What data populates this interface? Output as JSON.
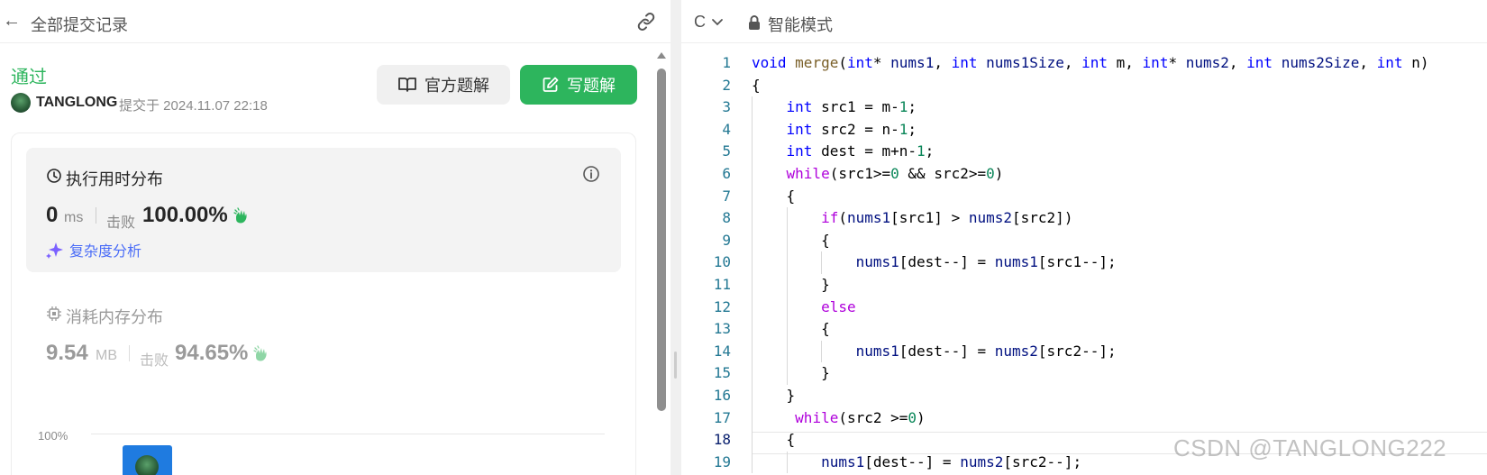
{
  "left_panel": {
    "back_label": "←",
    "title": "全部提交记录",
    "status": "通过",
    "username": "TANGLONG",
    "submitted_text": "提交于 2024.11.07 22:18",
    "official_solution_label": "官方题解",
    "write_solution_label": "写题解",
    "runtime": {
      "title": "执行用时分布",
      "value": "0",
      "unit": "ms",
      "beat_label": "击败",
      "beat_pct": "100.00%",
      "complexity_label": "复杂度分析"
    },
    "memory": {
      "title": "消耗内存分布",
      "value": "9.54",
      "unit": "MB",
      "beat_label": "击败",
      "beat_pct": "94.65%"
    },
    "chart": {
      "axis_top_label": "100%"
    }
  },
  "editor": {
    "language": "C",
    "mode": "智能模式",
    "active_line": 18,
    "lines": [
      "void merge(int* nums1, int nums1Size, int m, int* nums2, int nums2Size, int n)",
      "{",
      "    int src1 = m-1;",
      "    int src2 = n-1;",
      "    int dest = m+n-1;",
      "    while(src1>=0 && src2>=0)",
      "    {",
      "        if(nums1[src1] > nums2[src2])",
      "        {",
      "            nums1[dest--] = nums1[src1--];",
      "        }",
      "        else",
      "        {",
      "            nums1[dest--] = nums2[src2--];",
      "        }",
      "    }",
      "     while(src2 >=0)",
      "    {",
      "        nums1[dest--] = nums2[src2--];"
    ]
  },
  "watermark": "CSDN @TANGLONG222",
  "colors": {
    "accent_green": "#2db55d",
    "link_blue": "#4a6cf7",
    "keyword_blue": "#0000ff",
    "control_purple": "#af00db",
    "number_green": "#098658"
  }
}
